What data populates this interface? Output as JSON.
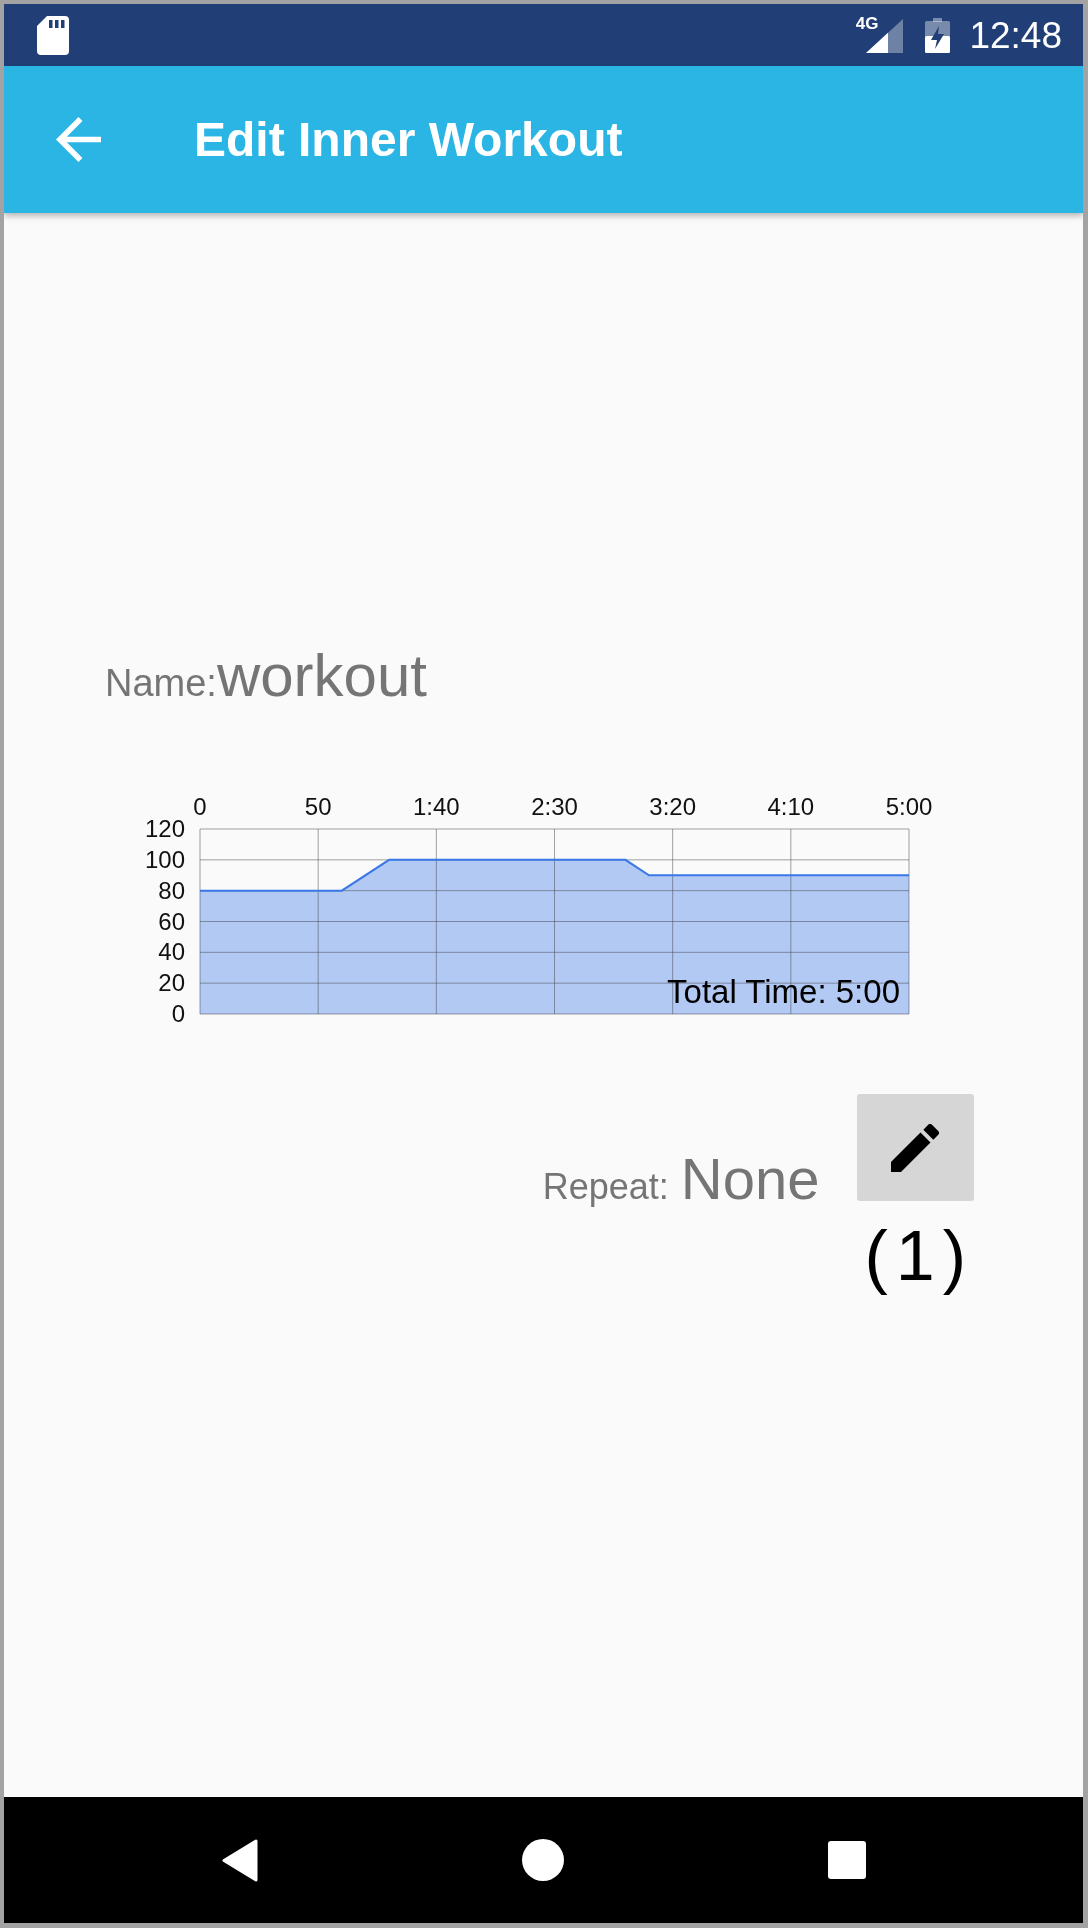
{
  "status_bar": {
    "network_type": "4G",
    "time": "12:48"
  },
  "app_bar": {
    "title": "Edit Inner Workout"
  },
  "name": {
    "label": "Name:",
    "value": "workout"
  },
  "chart": {
    "chart_data": {
      "type": "area",
      "x": [
        0,
        60,
        80,
        180,
        190,
        300
      ],
      "series": [
        {
          "color": "#3b78e7",
          "values": [
            80,
            80,
            100,
            100,
            90,
            90
          ]
        }
      ],
      "xlim": [
        0,
        300
      ],
      "ylim": [
        0,
        120
      ],
      "xticks": [
        0,
        50,
        {
          "value": 100,
          "label": "1:40"
        },
        {
          "value": 150,
          "label": "2:30"
        },
        {
          "value": 200,
          "label": "3:20"
        },
        {
          "value": 250,
          "label": "4:10"
        },
        {
          "value": 300,
          "label": "5:00"
        }
      ],
      "yticks": [
        0,
        20,
        40,
        60,
        80,
        100,
        120
      ],
      "grid": true,
      "annotations": [
        {
          "text": "Total Time: 5:00"
        }
      ]
    }
  },
  "repeat": {
    "label": "Repeat:",
    "value": "None",
    "count": "(1)"
  }
}
